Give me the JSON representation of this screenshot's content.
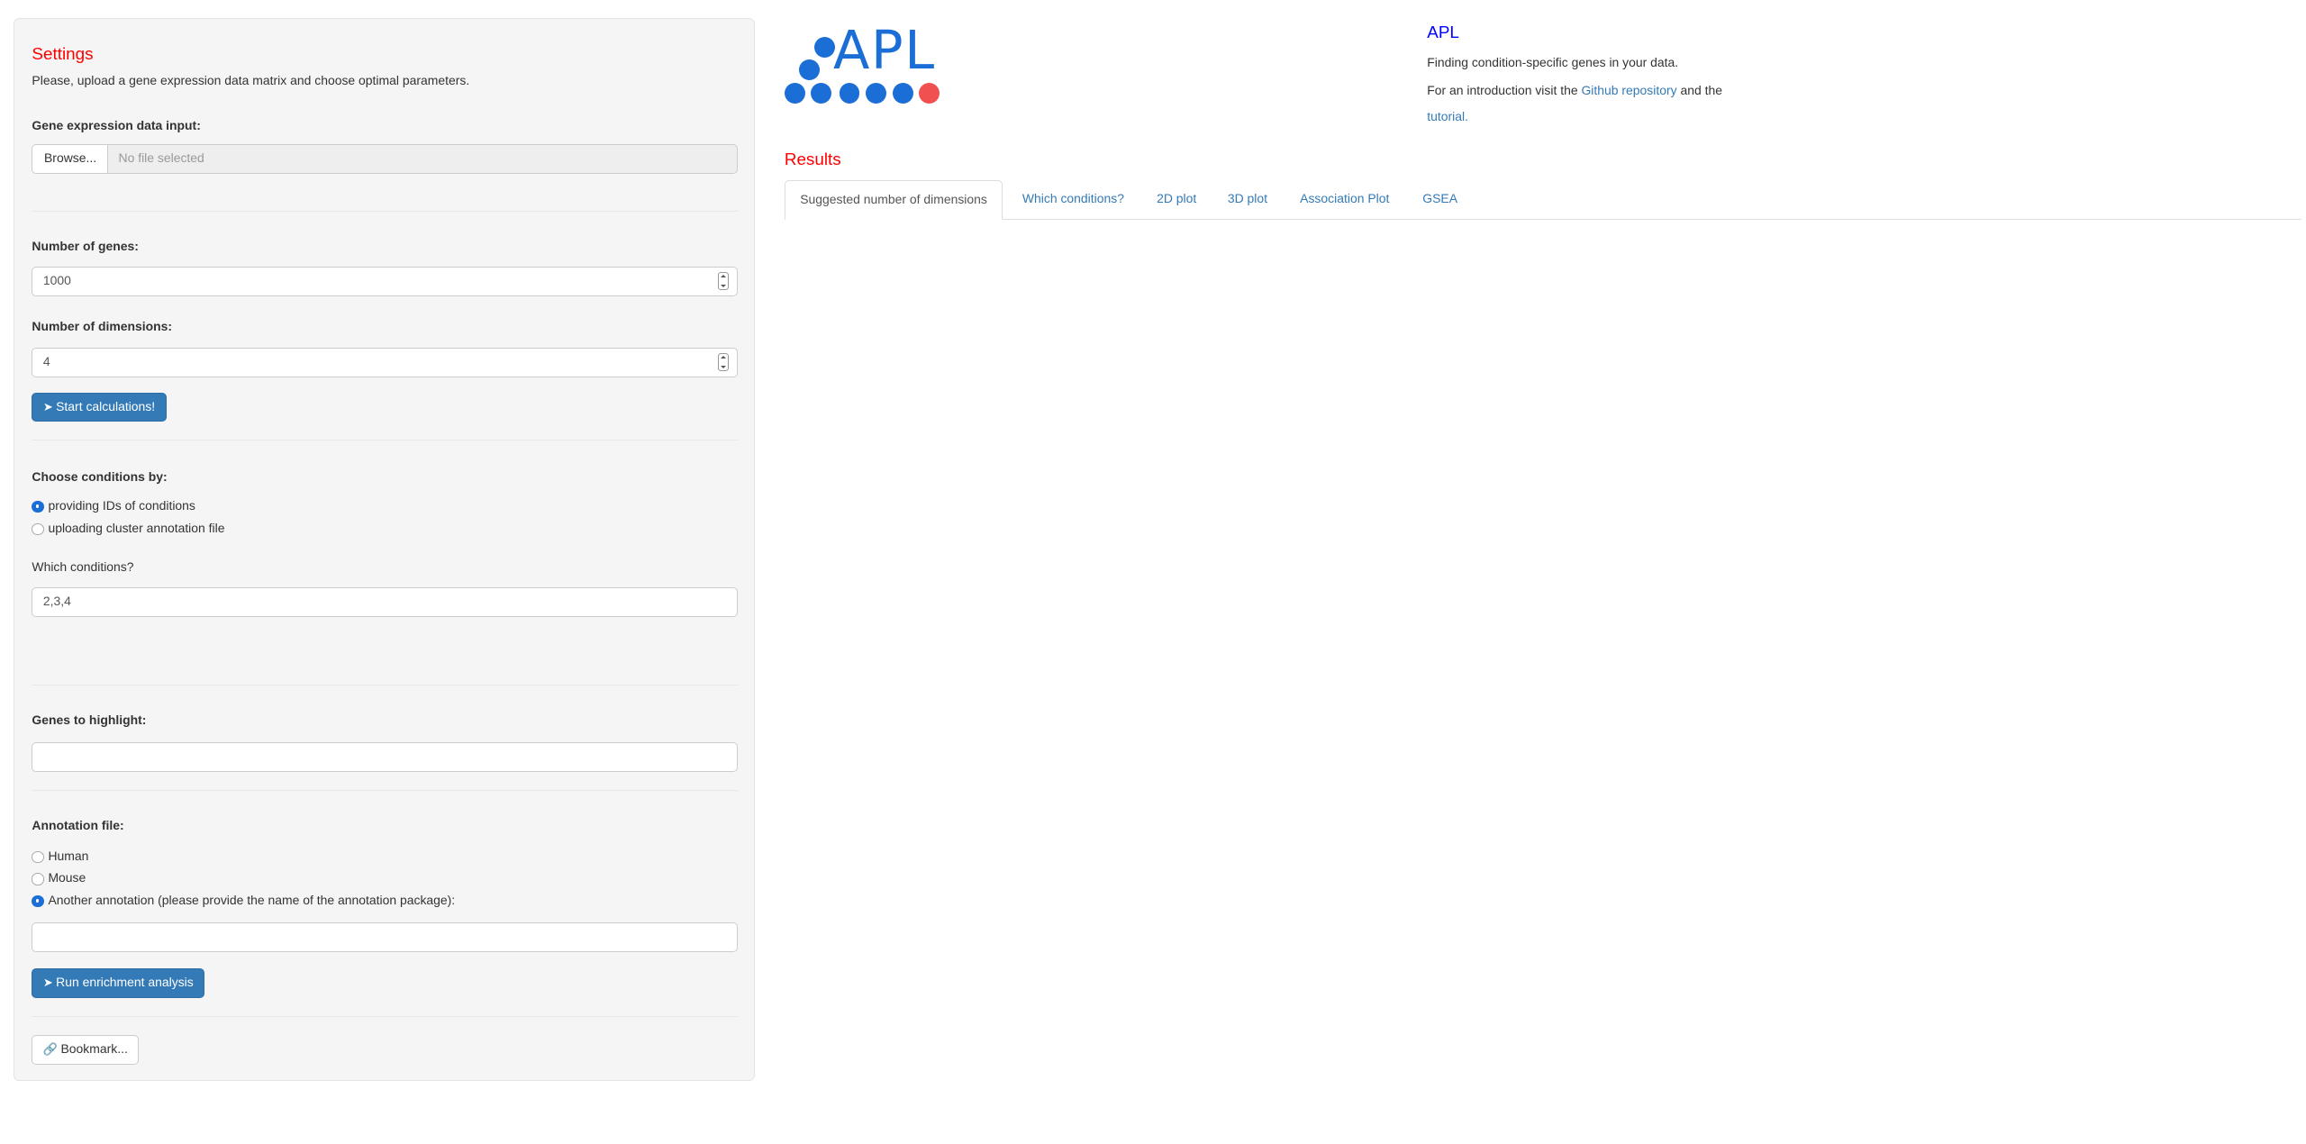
{
  "sidebar": {
    "title": "Settings",
    "subtitle": "Please, upload a gene expression data matrix and choose optimal parameters.",
    "gene_input_label": "Gene expression data input:",
    "browse_label": "Browse...",
    "file_placeholder": "No file selected",
    "num_genes_label": "Number of genes:",
    "num_genes_value": "1000",
    "num_dims_label": "Number of dimensions:",
    "num_dims_value": "4",
    "start_button": "Start calculations!",
    "choose_conditions_label": "Choose conditions by:",
    "condition_options": [
      "providing IDs of conditions",
      "uploading cluster annotation file"
    ],
    "condition_selected": 0,
    "which_conditions_label": "Which conditions?",
    "which_conditions_value": "2,3,4",
    "genes_highlight_label": "Genes to highlight:",
    "genes_highlight_value": "",
    "annotation_label": "Annotation file:",
    "annotation_options": [
      "Human",
      "Mouse",
      "Another annotation (please provide the name of the annotation package):"
    ],
    "annotation_selected": 2,
    "annotation_package_value": "",
    "run_button": "Run enrichment analysis",
    "bookmark_button": "Bookmark..."
  },
  "header": {
    "logo_text": "APL",
    "app_title": "APL",
    "description": "Finding condition-specific genes in your data.",
    "intro_prefix": "For an introduction visit the ",
    "github_link": "Github repository",
    "intro_mid": " and the",
    "tutorial_link": "tutorial."
  },
  "results": {
    "title": "Results",
    "tabs": [
      "Suggested number of dimensions",
      "Which conditions?",
      "2D plot",
      "3D plot",
      "Association Plot",
      "GSEA"
    ],
    "active_tab": 0
  },
  "colors": {
    "accent": "#337ab7",
    "logo_blue": "#1b6ed6",
    "logo_red": "#f05050",
    "title_red": "#ff0000"
  }
}
